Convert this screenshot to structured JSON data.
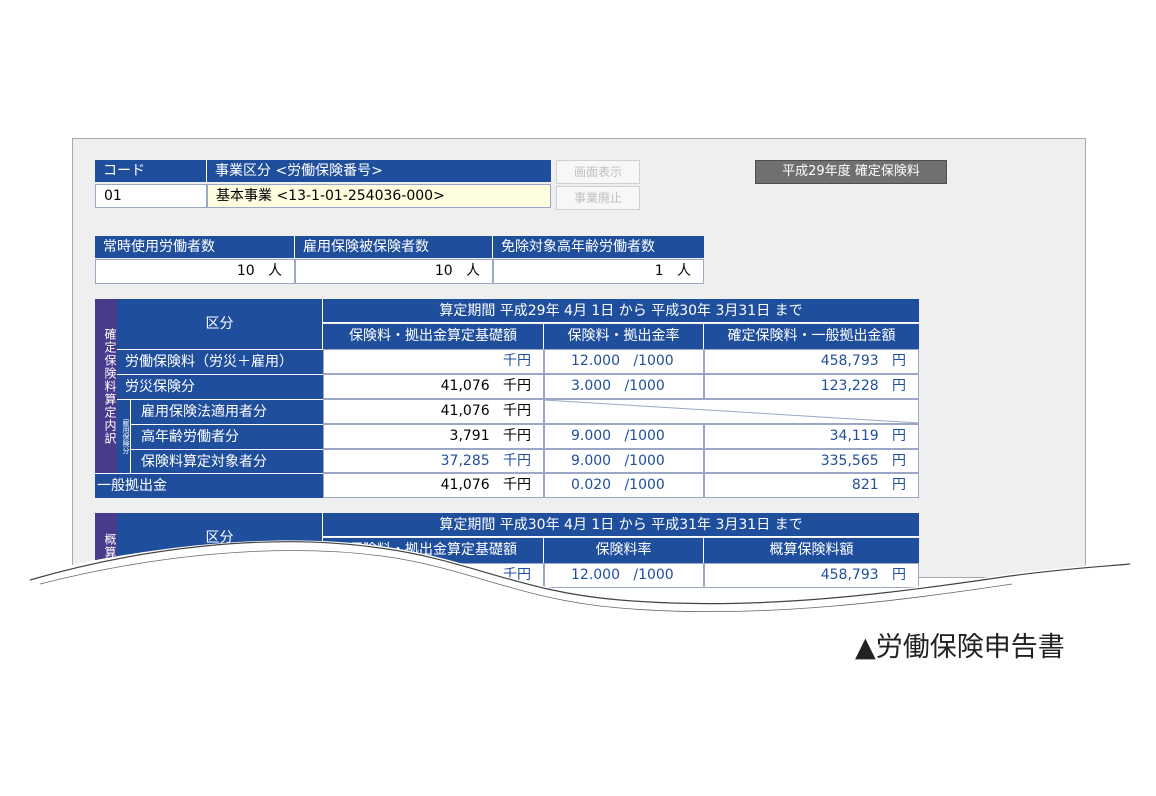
{
  "top": {
    "code_header": "コード",
    "division_header": "事業区分 <労働保険番号>",
    "code_value": "01",
    "division_value": "基本事業 <13-1-01-254036-000>",
    "display_button": "画面表示",
    "abolish_button": "事業廃止",
    "year_button": "平成29年度 確定保険料"
  },
  "workers": {
    "headers": [
      "常時使用労働者数",
      "雇用保険被保険者数",
      "免除対象高年齢労働者数"
    ],
    "values": [
      "10",
      "10",
      "1"
    ],
    "unit": "人"
  },
  "confirmed": {
    "side_label": "確定保険料算定内訳",
    "small_label": "雇用保険分",
    "category_header": "区分",
    "period": "算定期間 平成29年 4月 1日 から 平成30年 3月31日 まで",
    "col_base": "保険料・拠出金算定基礎額",
    "col_rate": "保険料・拠出金率",
    "col_amount": "確定保険料・一般拠出金額",
    "unit_thousand": "千円",
    "unit_per": "/1000",
    "unit_yen": "円",
    "rows": [
      {
        "label": "労働保険料（労災＋雇用）",
        "base": "",
        "rate": "12.000",
        "amount": "458,793"
      },
      {
        "label": "労災保険分",
        "base": "41,076",
        "rate": "3.000",
        "amount": "123,228"
      },
      {
        "label": "雇用保険法適用者分",
        "base": "41,076",
        "rate": "",
        "amount": ""
      },
      {
        "label": "高年齢労働者分",
        "base": "3,791",
        "rate": "9.000",
        "amount": "34,119"
      },
      {
        "label": "保険料算定対象者分",
        "base": "37,285",
        "rate": "9.000",
        "amount": "335,565"
      },
      {
        "label": "一般拠出金",
        "base": "41,076",
        "rate": "0.020",
        "amount": "821"
      }
    ]
  },
  "estimated": {
    "side_label": "概算",
    "category_header": "区分",
    "period": "算定期間 平成30年 4月 1日 から 平成31年 3月31日 まで",
    "col_base": "保険料・拠出金算定基礎額",
    "col_rate": "保険料率",
    "col_amount": "概算保険料額",
    "row_unit_partial": "千円",
    "row_rate": "12.000",
    "row_per": "/1000",
    "row_amount": "458,793",
    "row_yen": "円"
  },
  "caption": "▲労働保険申告書",
  "colors": {
    "header_blue": "#1f4e9c",
    "side_purple": "#4a3a8c"
  }
}
